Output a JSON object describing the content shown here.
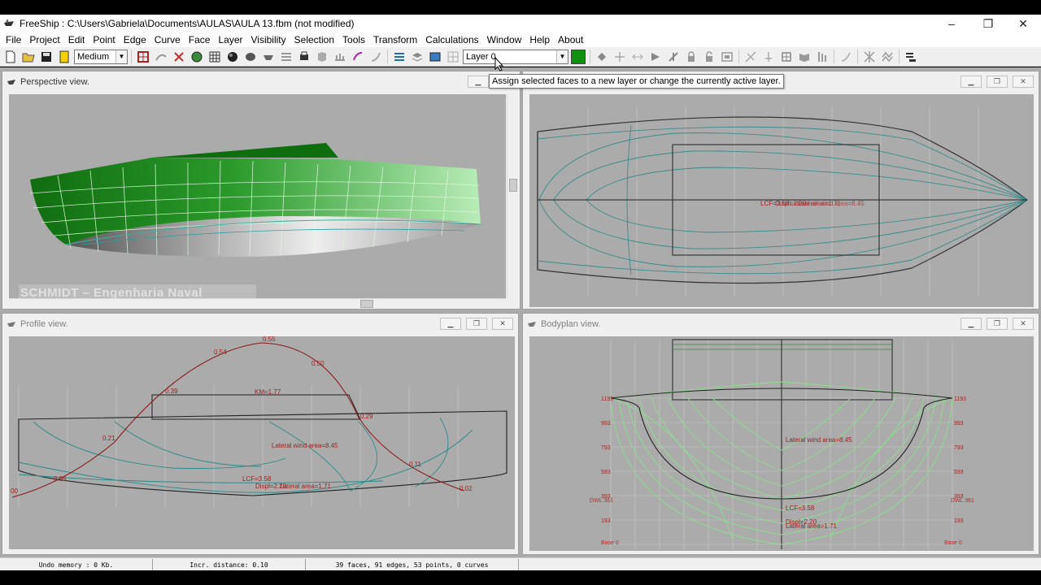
{
  "window": {
    "title": "FreeShip : C:\\Users\\Gabriela\\Documents\\AULAS\\AULA  13.fbm (not modified)",
    "controls": [
      "–",
      "❐",
      "✕"
    ]
  },
  "menu": [
    "File",
    "Project",
    "Edit",
    "Point",
    "Edge",
    "Curve",
    "Face",
    "Layer",
    "Visibility",
    "Selection",
    "Tools",
    "Transform",
    "Calculations",
    "Window",
    "Help",
    "About"
  ],
  "toolbar": {
    "precision_value": "Medium",
    "layer_value": "Layer 0",
    "layer_color": "#109010"
  },
  "tooltip": "Assign selected faces to a new layer or change the currently active layer.",
  "panes": {
    "perspective": {
      "title": "Perspective view."
    },
    "plan": {
      "title": ""
    },
    "profile": {
      "title": "Profile view."
    },
    "bodyplan": {
      "title": "Bodyplan view."
    }
  },
  "watermark": "SCHMIDT – Engenharia Naval",
  "plan_labels": {
    "lcf": "LCF=3.58",
    "disp": "Displ=2.20",
    "lat": "Lateral area=1.71",
    "wind": "Lateral wind area=8.45"
  },
  "profile_labels": {
    "km": "KM=1.77",
    "wind": "Lateral wind area=8.45",
    "lcf": "LCF=3.58",
    "disp": "Displ=2.20",
    "lat": "Lateral area=1.71",
    "v00": "00",
    "v05": "0.05",
    "v21": "0.21",
    "v39": "0.39",
    "v54": "0.54",
    "v55": "0.55",
    "v50": "0.50",
    "v29": "0.29",
    "v11": "0.11",
    "v02": "0.02"
  },
  "bodyplan_labels": {
    "wind": "Lateral wind area=8.45",
    "lcf": "LCF=3.58",
    "disp": "Displ=2.20",
    "lat": "Lateral area=1.71",
    "base_left": "Base 0",
    "base_right": "Base 0",
    "dwl_left": "DWL 361",
    "dwl_right": "DWL 361",
    "left_ticks": [
      "1193",
      "993",
      "793",
      "593",
      "393",
      "193"
    ],
    "right_ticks": [
      "1193",
      "993",
      "793",
      "593",
      "393",
      "193"
    ]
  },
  "status": {
    "undo": "Undo memory : 0 Kb.",
    "incr": "Incr. distance: 0.10",
    "counts": "39 faces, 91 edges, 53 points, 0 curves"
  }
}
